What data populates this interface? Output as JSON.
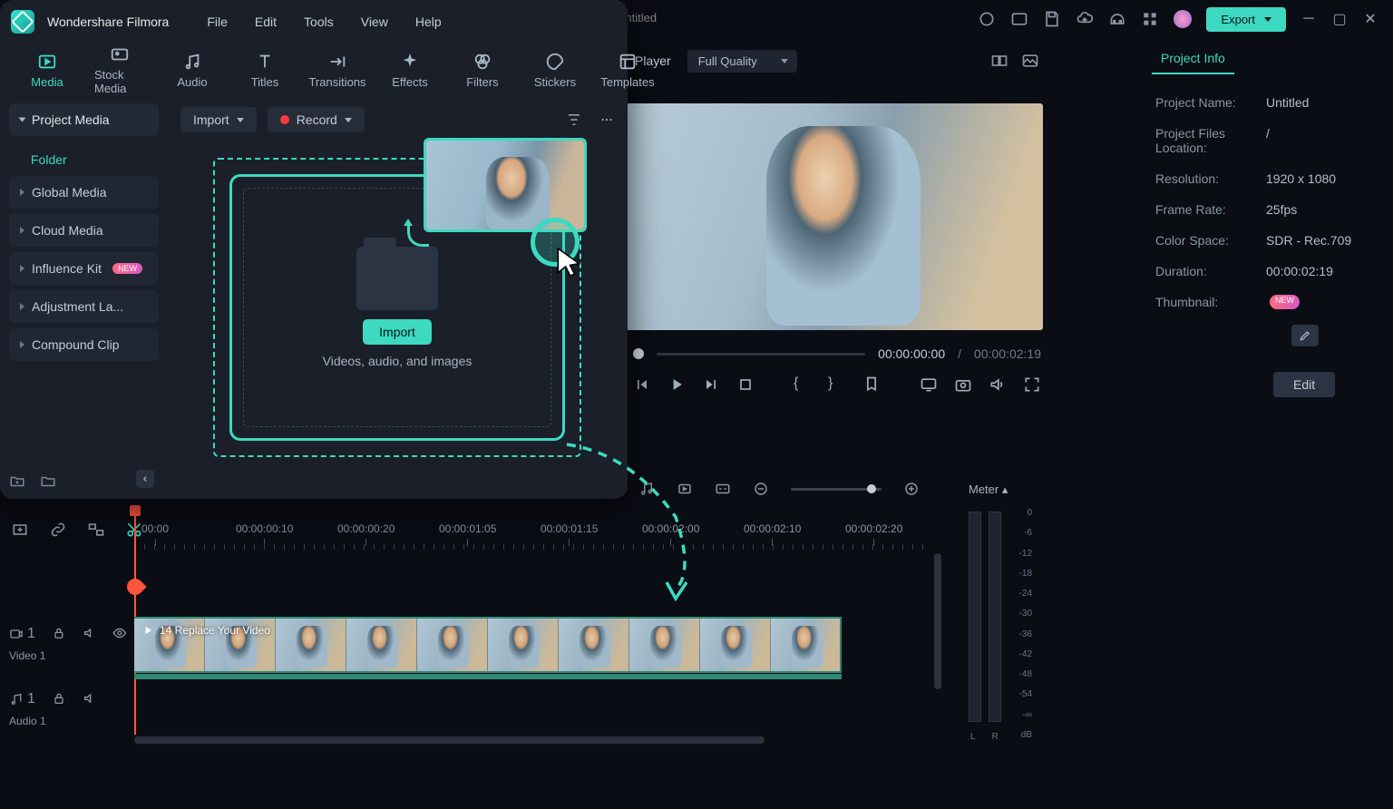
{
  "app": {
    "title": "Wondershare Filmora"
  },
  "project_title": "Untitled",
  "menubar": [
    "File",
    "Edit",
    "Tools",
    "View",
    "Help"
  ],
  "export_label": "Export",
  "asset_tabs": [
    {
      "label": "Media",
      "active": true
    },
    {
      "label": "Stock Media"
    },
    {
      "label": "Audio"
    },
    {
      "label": "Titles"
    },
    {
      "label": "Transitions"
    },
    {
      "label": "Effects"
    },
    {
      "label": "Filters"
    },
    {
      "label": "Stickers"
    },
    {
      "label": "Templates"
    }
  ],
  "toolbar": {
    "import_label": "Import",
    "record_label": "Record"
  },
  "sidebar": {
    "project_media": "Project Media",
    "folder": "Folder",
    "global": "Global Media",
    "cloud": "Cloud Media",
    "influence": "Influence Kit",
    "adjustment": "Adjustment La...",
    "compound": "Compound Clip",
    "new_badge": "NEW"
  },
  "dropzone": {
    "import_btn": "Import",
    "subtitle": "Videos, audio, and images"
  },
  "preview": {
    "player_label": "Player",
    "quality": "Full Quality",
    "current_time": "00:00:00:00",
    "separator": "/",
    "total_time": "00:00:02:19"
  },
  "projectInfo": {
    "title": "Project Info",
    "rows": {
      "name_label": "Project Name:",
      "name_value": "Untitled",
      "loc_label": "Project Files Location:",
      "loc_value": "/",
      "res_label": "Resolution:",
      "res_value": "1920 x 1080",
      "fr_label": "Frame Rate:",
      "fr_value": "25fps",
      "cs_label": "Color Space:",
      "cs_value": "SDR - Rec.709",
      "dur_label": "Duration:",
      "dur_value": "00:00:02:19",
      "thumb_label": "Thumbnail:",
      "thumb_badge": "NEW"
    },
    "edit_btn": "Edit"
  },
  "meter": {
    "label": "Meter ▴",
    "scale": [
      "0",
      "-6",
      "-12",
      "-18",
      "-24",
      "-30",
      "-36",
      "-42",
      "-48",
      "-54",
      "-∞",
      "dB"
    ],
    "L": "L",
    "R": "R"
  },
  "timeline": {
    "ruler": [
      "00:00",
      "00:00:00:10",
      "00:00:00:20",
      "00:00:01:05",
      "00:00:01:15",
      "00:00:02:00",
      "00:00:02:10",
      "00:00:02:20"
    ],
    "video_track_label": "Video 1",
    "audio_track_label": "Audio 1",
    "video_track_num": "1",
    "audio_track_num": "1",
    "clip_name": "14 Replace Your Video"
  }
}
